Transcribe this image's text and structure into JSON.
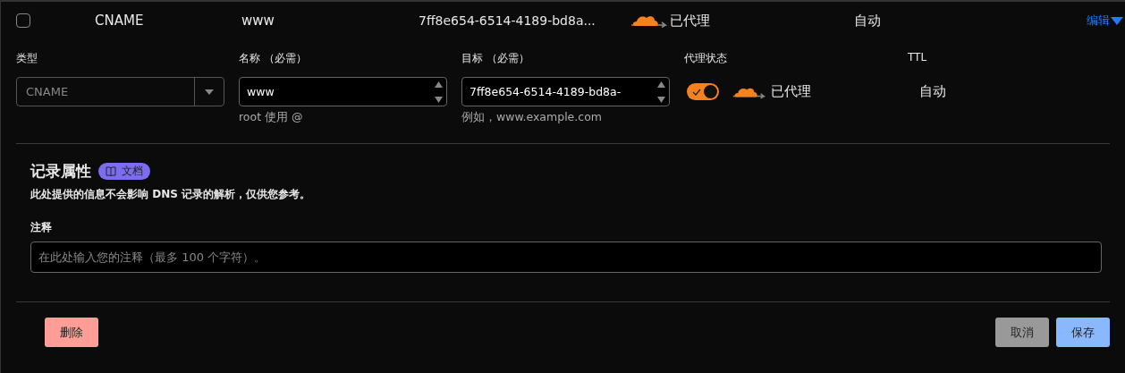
{
  "record_row": {
    "checked": false,
    "type": "CNAME",
    "name": "www",
    "content": "7ff8e654-6514-4189-bd8a...",
    "proxy_status": "已代理",
    "ttl": "自动",
    "edit_link": "编辑",
    "expanded": true
  },
  "form": {
    "fields": [
      {
        "kind": "select",
        "label": "类型",
        "value": "CNAME",
        "disabled": true
      },
      {
        "kind": "text",
        "label": "名称 （必需）",
        "value": "www",
        "hint": "root 使用 @"
      },
      {
        "kind": "textarea",
        "label": "目标 （必需）",
        "value": "7ff8e654-6514-4189-bd8a-",
        "hint": "例如，www.example.com"
      },
      {
        "kind": "proxy",
        "label": "代理状态",
        "on": true,
        "status": "已代理"
      },
      {
        "kind": "static",
        "label": "TTL",
        "value": "自动"
      }
    ]
  },
  "attributes": {
    "title": "记录属性",
    "docs_badge": "文档",
    "description": "此处提供的信息不会影响 DNS 记录的解析，仅供您参考。",
    "comment": {
      "label": "注释",
      "placeholder": "在此处输入您的注释（最多 100 个字符）。"
    }
  },
  "actions": {
    "delete": "删除",
    "cancel": "取消",
    "save": "保存"
  }
}
